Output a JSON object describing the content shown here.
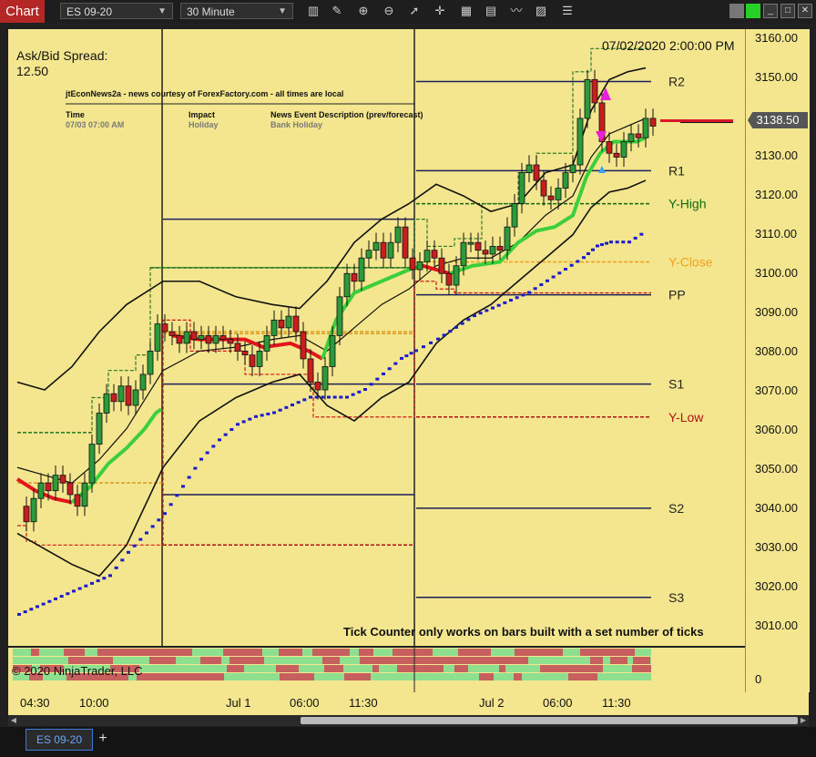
{
  "toolbar": {
    "chart_tab": "Chart",
    "instrument": "ES 09-20",
    "interval": "30 Minute"
  },
  "chart": {
    "spread_label": "Ask/Bid Spread:",
    "spread_value": "12.50",
    "timestamp": "07/02/2020 2:00:00 PM",
    "news_title": "jtEconNews2a - news courtesy of ForexFactory.com - all times are local",
    "news_col_time": "Time",
    "news_col_impact": "Impact",
    "news_col_desc": "News Event Description (prev/forecast)",
    "news_time": "07/03 07:00 AM",
    "news_impact": "Holiday",
    "news_desc": "Bank Holiday",
    "tick_note": "Tick Counter only works on bars built with a set number of ticks",
    "copyright": "© 2020 NinjaTrader, LLC",
    "last_price": "3138.50",
    "colors": {
      "background": "#f3e68e",
      "ma_up": "#3ccf3c",
      "ma_down": "#e3141b",
      "dots": "#1a1ad0",
      "pivot": "#1c1f5a",
      "y_high": "#0f6a0f",
      "y_close": "#f0a020",
      "y_low": "#b01414"
    }
  },
  "pivots": [
    {
      "label": "R2",
      "price": 3149.5
    },
    {
      "label": "R1",
      "price": 3126.5
    },
    {
      "label": "Y-High",
      "price": 3118.0
    },
    {
      "label": "Y-Close",
      "price": 3103.0
    },
    {
      "label": "PP",
      "price": 3094.5
    },
    {
      "label": "S1",
      "price": 3071.5
    },
    {
      "label": "Y-Low",
      "price": 3063.0
    },
    {
      "label": "S2",
      "price": 3039.5
    },
    {
      "label": "S3",
      "price": 3016.5
    }
  ],
  "y_axis": {
    "ticks": [
      "3160.00",
      "3150.00",
      "3140.00",
      "3130.00",
      "3120.00",
      "3110.00",
      "3100.00",
      "3090.00",
      "3080.00",
      "3070.00",
      "3060.00",
      "3050.00",
      "3040.00",
      "3030.00",
      "3020.00",
      "3010.00"
    ],
    "range": [
      3004,
      3163
    ],
    "indicator_tick": "0"
  },
  "x_axis": {
    "ticks": [
      "04:30",
      "10:00",
      "Jul 1",
      "06:00",
      "11:30",
      "Jul 2",
      "06:00",
      "11:30"
    ]
  },
  "bottom": {
    "tab": "ES 09-20"
  }
}
